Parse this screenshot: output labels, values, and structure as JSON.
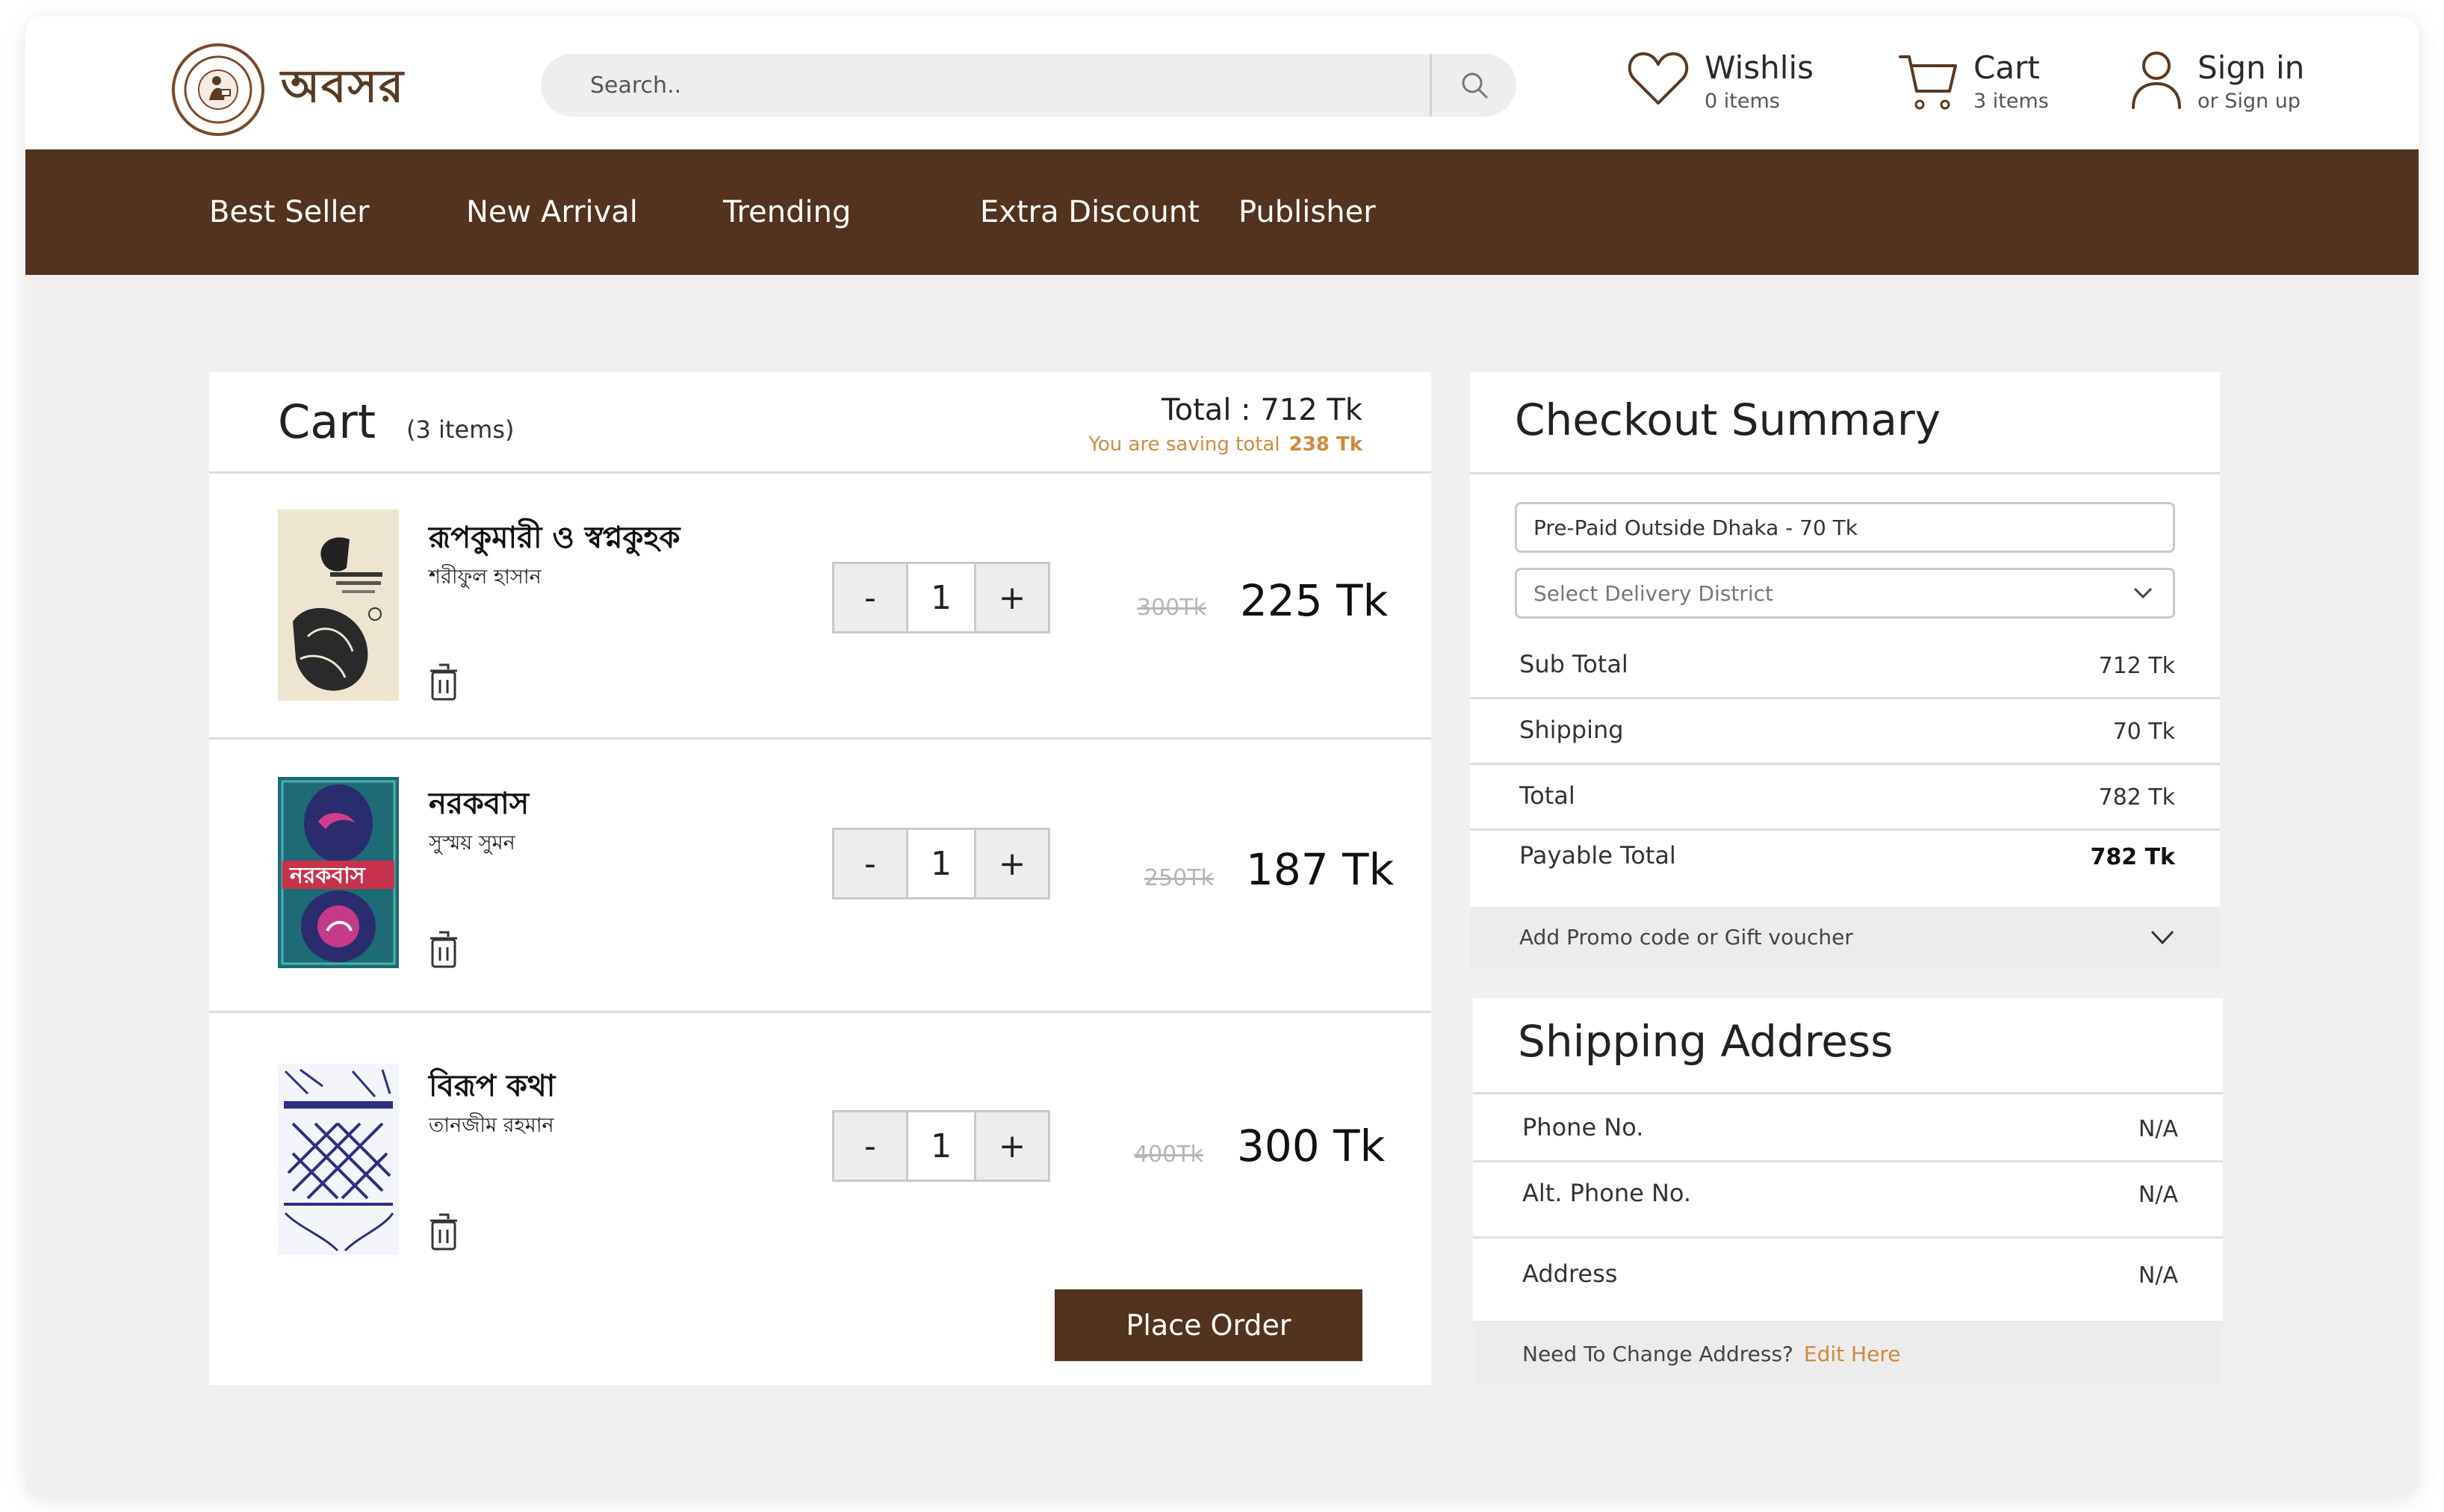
{
  "header": {
    "logo_text": "অবসর",
    "search_placeholder": "Search..",
    "wishlist": {
      "title": "Wishlis",
      "subtitle": "0 items"
    },
    "cart": {
      "title": "Cart",
      "subtitle": "3 items"
    },
    "account": {
      "title": "Sign in",
      "subtitle": "or Sign up"
    }
  },
  "nav": {
    "items": [
      {
        "label": "Best Seller"
      },
      {
        "label": "New Arrival"
      },
      {
        "label": "Trending"
      },
      {
        "label": "Extra Discount"
      },
      {
        "label": "Publisher"
      }
    ]
  },
  "cart": {
    "title": "Cart",
    "count": "(3 items)",
    "total": "Total : 712 Tk",
    "saving_label": "You are saving total",
    "saving_value": "238 Tk",
    "items": [
      {
        "title": "রূপকুমারী ও স্বপ্নকুহক",
        "author": "শরীফুল হাসান",
        "quantity": "1",
        "minus": "-",
        "plus": "+",
        "old_price": "300Tk",
        "price": "225 Tk"
      },
      {
        "title": "নরকবাস",
        "author": "সুস্ময় সুমন",
        "quantity": "1",
        "minus": "-",
        "plus": "+",
        "old_price": "250Tk",
        "price": "187 Tk"
      },
      {
        "title": "বিরূপ কথা",
        "author": "তানজীম রহমান",
        "quantity": "1",
        "minus": "-",
        "plus": "+",
        "old_price": "400Tk",
        "price": "300 Tk"
      }
    ],
    "place_order": "Place Order"
  },
  "checkout": {
    "title": "Checkout Summary",
    "delivery_option": "Pre-Paid Outside Dhaka   -  70 Tk",
    "district_placeholder": "Select Delivery District",
    "rows": [
      {
        "label": "Sub Total",
        "value": "712 Tk"
      },
      {
        "label": "Shipping",
        "value": "70 Tk"
      },
      {
        "label": "Total",
        "value": "782 Tk"
      },
      {
        "label": "Payable Total",
        "value": "782 Tk"
      }
    ],
    "promo": "Add Promo code or Gift voucher"
  },
  "shipping": {
    "title": "Shipping Address",
    "rows": [
      {
        "label": "Phone No.",
        "value": "N/A"
      },
      {
        "label": "Alt. Phone No.",
        "value": "N/A"
      },
      {
        "label": "Address",
        "value": "N/A"
      }
    ],
    "change_label": "Need To Change Address?",
    "edit_link": "Edit Here"
  },
  "colors": {
    "brand_brown": "#52331f",
    "accent_orange": "#d08a3a",
    "background": "#f1f0ef"
  },
  "icons": [
    "heart-icon",
    "cart-icon",
    "user-icon",
    "search-icon",
    "trash-icon",
    "chevron-down-icon"
  ]
}
